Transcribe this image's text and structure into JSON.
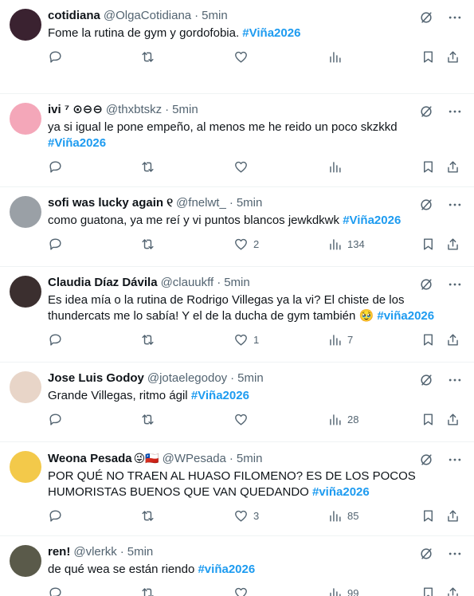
{
  "tweets": [
    {
      "name": "cotidiana",
      "handle": "@OlgaCotidiana",
      "time": "5min",
      "text": "Fome la rutina de gym y gordofobia.",
      "hashtag": "#Viña2026",
      "avatar_color": "#3a2230",
      "likes": "",
      "views": ""
    },
    {
      "name": "ivi ⁷ ⊙⊖⊖",
      "handle": "@thxbtskz",
      "time": "5min",
      "text": "ya si igual le pone empeño, al menos me he reido un poco skzkkd",
      "hashtag": "#Viña2026",
      "avatar_color": "#f4a7b9",
      "likes": "",
      "views": ""
    },
    {
      "name": "sofi was lucky again ୧",
      "handle": "@fnelwt_",
      "time": "5min",
      "text": "como guatona, ya me reí y vi puntos blancos jewkdkwk",
      "hashtag": "#Viña2026",
      "avatar_color": "#9aa0a6",
      "likes": "2",
      "views": "134"
    },
    {
      "name": "Claudia Díaz Dávila",
      "handle": "@clauukff",
      "time": "5min",
      "text": "Es idea mía o la rutina de Rodrigo Villegas ya la vi? El chiste de los thundercats me lo sabía! Y el de la ducha de gym también 🥹",
      "hashtag": "#viña2026",
      "avatar_color": "#3b2f2f",
      "likes": "1",
      "views": "7"
    },
    {
      "name": "Jose Luis Godoy",
      "handle": "@jotaelegodoy",
      "time": "5min",
      "text": "Grande Villegas, ritmo ágil",
      "hashtag": "#Viña2026",
      "avatar_color": "#e8d5c8",
      "likes": "",
      "views": "28"
    },
    {
      "name": "Weona Pesada",
      "name_emoji": "😜🇨🇱",
      "handle": "@WPesada",
      "time": "5min",
      "text": "POR QUÉ NO TRAEN AL HUASO FILOMENO? ES DE LOS POCOS HUMORISTAS BUENOS QUE VAN QUEDANDO",
      "hashtag": "#viña2026",
      "avatar_color": "#f3c94a",
      "likes": "3",
      "views": "85"
    },
    {
      "name": "ren!",
      "handle": "@vlerkk",
      "time": "5min",
      "text": "de qué wea se están riendo",
      "hashtag": "#viña2026",
      "avatar_color": "#5a5a4a",
      "likes": "",
      "views": "99"
    }
  ],
  "separator": "·",
  "icons": {
    "reply": "reply-icon",
    "retweet": "retweet-icon",
    "like": "like-icon",
    "views": "views-icon",
    "bookmark": "bookmark-icon",
    "share": "share-icon",
    "grok": "grok-icon",
    "more": "more-icon"
  },
  "colors": {
    "accent": "#1d9bf0",
    "text": "#0f1419",
    "muted": "#536471",
    "border": "#eff3f4"
  }
}
